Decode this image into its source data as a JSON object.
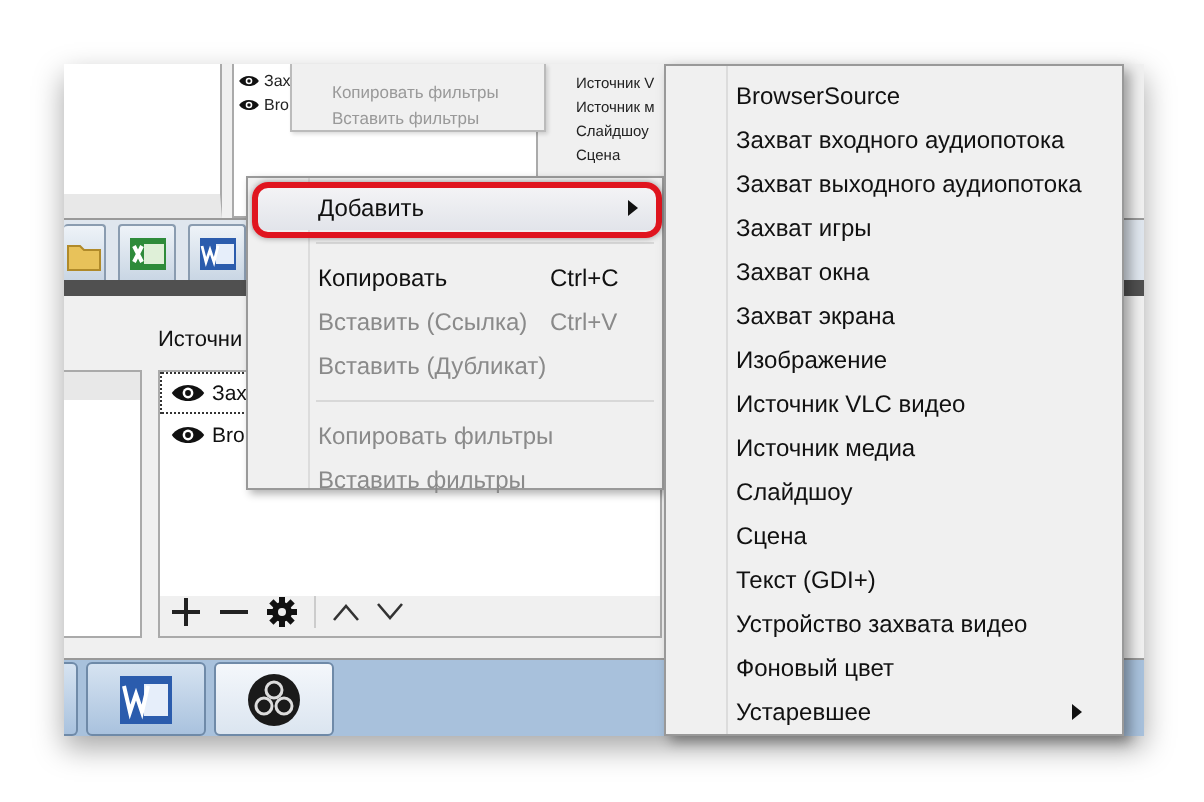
{
  "top_sources": [
    {
      "label": "Зах"
    },
    {
      "label": "Bro"
    }
  ],
  "ghost_menu": {
    "items": [
      {
        "label": "Копировать фильтры",
        "disabled": true
      },
      {
        "label": "Вставить фильтры",
        "disabled": true
      }
    ]
  },
  "ghost_submenu": {
    "items": [
      "Источник V",
      "Источник м",
      "Слайдшоу",
      "Сцена"
    ]
  },
  "sources_panel": {
    "title": "Источни",
    "items": [
      {
        "label": "Зах",
        "focused": true
      },
      {
        "label": "Bro",
        "focused": false
      }
    ]
  },
  "context_menu": {
    "items": [
      {
        "kind": "item",
        "label": "Добавить",
        "selected": true,
        "disabled": false,
        "submenu": true
      },
      {
        "kind": "separator"
      },
      {
        "kind": "item",
        "label": "Копировать",
        "shortcut": "Ctrl+C",
        "selected": false,
        "disabled": false,
        "submenu": false
      },
      {
        "kind": "item",
        "label": "Вставить (Ссылка)",
        "shortcut": "Ctrl+V",
        "selected": false,
        "disabled": true,
        "submenu": false
      },
      {
        "kind": "item",
        "label": "Вставить (Дубликат)",
        "selected": false,
        "disabled": true,
        "submenu": false
      },
      {
        "kind": "separator"
      },
      {
        "kind": "item",
        "label": "Копировать фильтры",
        "selected": false,
        "disabled": true,
        "submenu": false
      },
      {
        "kind": "item",
        "label": "Вставить фильтры",
        "selected": false,
        "disabled": true,
        "submenu": false
      }
    ]
  },
  "submenu": {
    "items": [
      {
        "label": "BrowserSource",
        "submenu": false
      },
      {
        "label": "Захват входного аудиопотока",
        "submenu": false
      },
      {
        "label": "Захват выходного аудиопотока",
        "submenu": false
      },
      {
        "label": "Захват игры",
        "submenu": false
      },
      {
        "label": "Захват окна",
        "submenu": false
      },
      {
        "label": "Захват экрана",
        "submenu": false
      },
      {
        "label": "Изображение",
        "submenu": false
      },
      {
        "label": "Источник VLC видео",
        "submenu": false
      },
      {
        "label": "Источник медиа",
        "submenu": false
      },
      {
        "label": "Слайдшоу",
        "submenu": false
      },
      {
        "label": "Сцена",
        "submenu": false
      },
      {
        "label": "Текст (GDI+)",
        "submenu": false
      },
      {
        "label": "Устройство захвата видео",
        "submenu": false
      },
      {
        "label": "Фоновый цвет",
        "submenu": false
      },
      {
        "label": "Устаревшее",
        "submenu": true
      }
    ]
  }
}
